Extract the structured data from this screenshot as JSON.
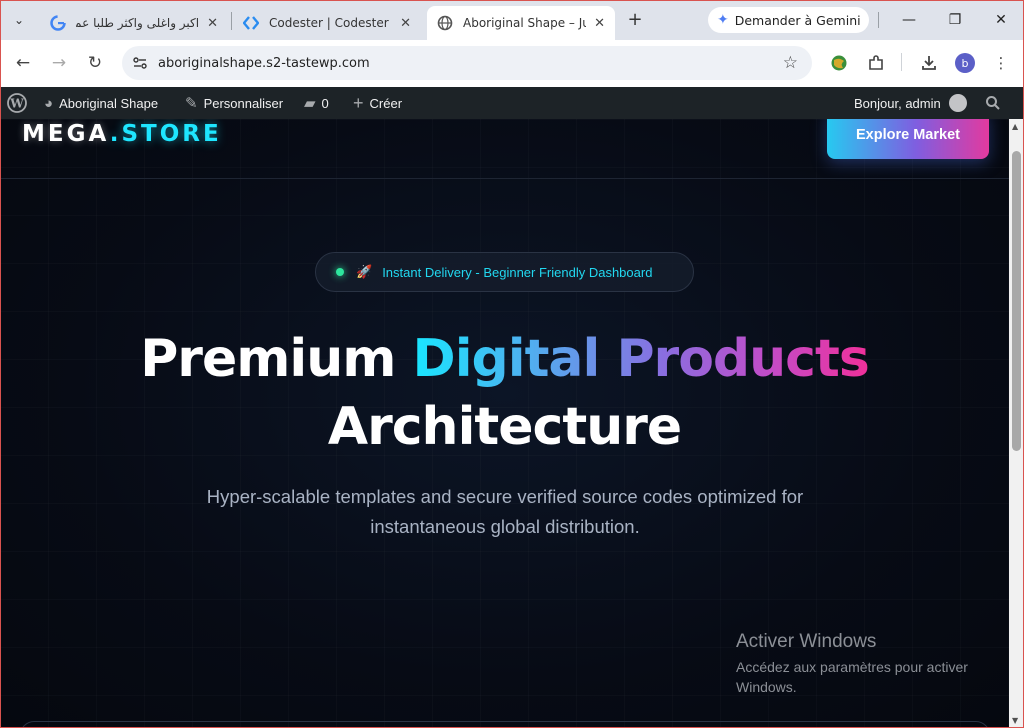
{
  "browser": {
    "tabs": [
      {
        "title": "اكبر واغلى واكثر طلبا عمل"
      },
      {
        "title": "Codester | Codester"
      },
      {
        "title": "Aboriginal Shape – Just"
      }
    ],
    "gemini_label": "Demander à Gemini",
    "url": "aboriginalshape.s2-tastewp.com",
    "profile_initial": "b"
  },
  "adminbar": {
    "site_name": "Aboriginal Shape",
    "customize": "Personnaliser",
    "comments_count": "0",
    "new_label": "Créer",
    "greeting": "Bonjour, admin"
  },
  "site": {
    "logo_main": "MEGA",
    "logo_accent": ".STORE",
    "explore_button": "Explore Market",
    "badge_text": "Instant Delivery - Beginner Friendly Dashboard",
    "title_part1": "Premium ",
    "title_grad": "Digital Products",
    "title_line2": "Architecture",
    "subtitle": "Hyper-scalable templates and secure verified source codes optimized for instantaneous global distribution."
  },
  "windows_notice": {
    "heading": "Activer Windows",
    "body": "Accédez aux paramètres pour activer Windows."
  },
  "colors": {
    "accent_cyan": "#1ee6ff",
    "accent_pink": "#f0309a",
    "page_bg": "#070b15",
    "adminbar_bg": "#1d2327"
  }
}
